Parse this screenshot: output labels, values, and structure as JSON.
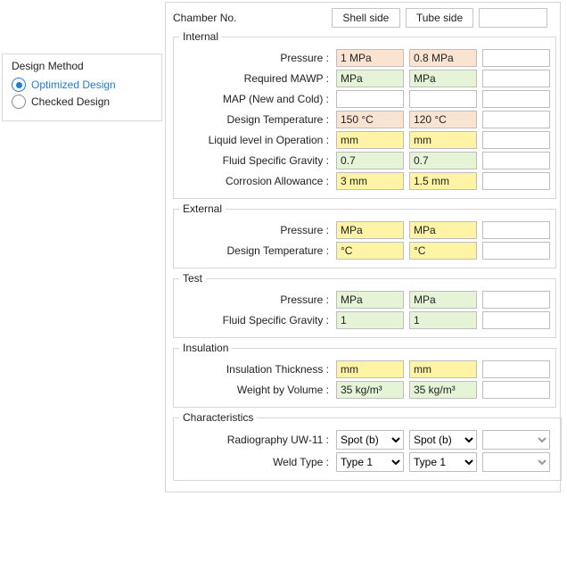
{
  "designMethod": {
    "title": "Design Method",
    "opt1": "Optimized Design",
    "opt2": "Checked Design"
  },
  "headers": {
    "chamber": "Chamber No.",
    "shell": "Shell side",
    "tube": "Tube side",
    "blank": ""
  },
  "internal": {
    "legend": "Internal",
    "pressure": {
      "label": "Pressure :",
      "shell": "1 MPa",
      "tube": "0.8 MPa"
    },
    "mawp": {
      "label": "Required MAWP :",
      "shell": "MPa",
      "tube": "MPa"
    },
    "map": {
      "label": "MAP (New and Cold) :"
    },
    "dtemp": {
      "label": "Design Temperature :",
      "shell": "150 °C",
      "tube": "120 °C"
    },
    "liq": {
      "label": "Liquid level in Operation :",
      "shell": "mm",
      "tube": "mm"
    },
    "sg": {
      "label": "Fluid Specific Gravity :",
      "shell": "0.7",
      "tube": "0.7"
    },
    "corr": {
      "label": "Corrosion Allowance :",
      "shell": "3 mm",
      "tube": "1.5 mm"
    }
  },
  "external": {
    "legend": "External",
    "pressure": {
      "label": "Pressure :",
      "shell": "MPa",
      "tube": "MPa"
    },
    "dtemp": {
      "label": "Design Temperature :",
      "shell": "°C",
      "tube": "°C"
    }
  },
  "test": {
    "legend": "Test",
    "pressure": {
      "label": "Pressure :",
      "shell": "MPa",
      "tube": "MPa"
    },
    "sg": {
      "label": "Fluid Specific Gravity :",
      "shell": "1",
      "tube": "1"
    }
  },
  "insulation": {
    "legend": "Insulation",
    "thk": {
      "label": "Insulation Thickness :",
      "shell": "mm",
      "tube": "mm"
    },
    "wbv": {
      "label": "Weight by Volume :",
      "shell": "35 kg/m³",
      "tube": "35 kg/m³"
    }
  },
  "characteristics": {
    "legend": "Characteristics",
    "rad": {
      "label": "Radiography UW-11 :",
      "shell": "Spot (b)",
      "tube": "Spot (b)"
    },
    "weld": {
      "label": "Weld Type :",
      "shell": "Type 1",
      "tube": "Type 1"
    }
  }
}
